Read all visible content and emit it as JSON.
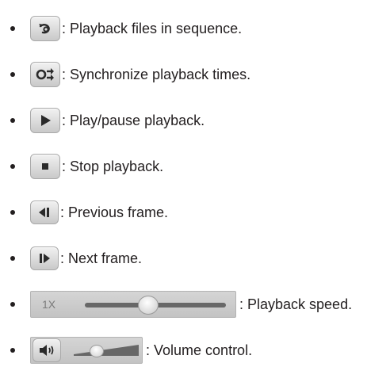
{
  "items": [
    {
      "icon": "sequence-playback-icon",
      "label": ": Playback files in sequence."
    },
    {
      "icon": "sync-playback-icon",
      "label": ": Synchronize playback times."
    },
    {
      "icon": "play-pause-icon",
      "label": ": Play/pause playback."
    },
    {
      "icon": "stop-icon",
      "label": ": Stop playback."
    },
    {
      "icon": "previous-frame-icon",
      "label": ": Previous frame."
    },
    {
      "icon": "next-frame-icon",
      "label": ": Next frame."
    },
    {
      "icon": "speed-slider",
      "label": ": Playback speed.",
      "speed_text": "1X",
      "level": 0.45
    },
    {
      "icon": "volume-slider",
      "label": ": Volume control.",
      "level": 0.35
    }
  ],
  "colors": {
    "text": "#231f20",
    "icon_glyph": "#2a2a2a",
    "track": "#676767"
  }
}
